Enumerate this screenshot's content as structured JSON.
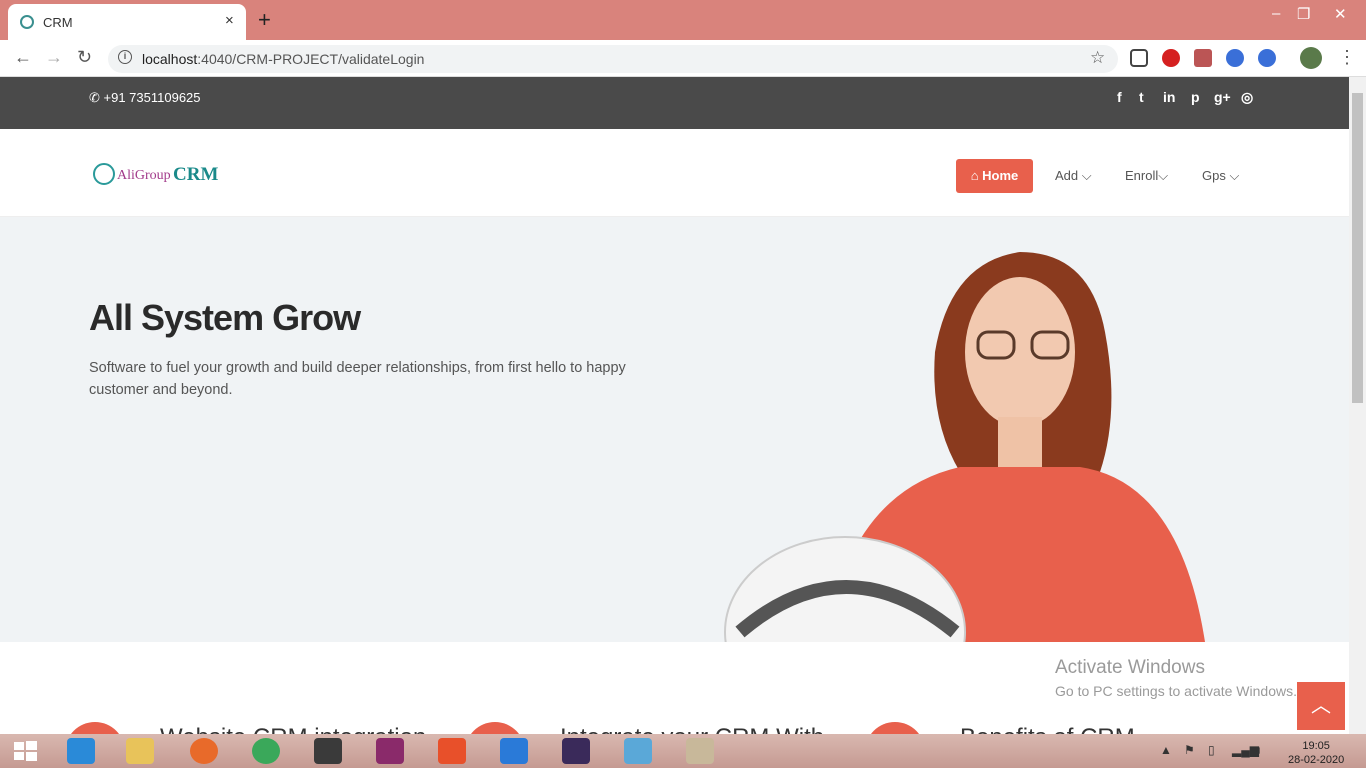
{
  "browser": {
    "tab_title": "CRM",
    "tab_close": "×",
    "new_tab": "+",
    "url_host": "localhost",
    "url_rest": ":4040/CRM-PROJECT/validateLogin",
    "win_minimize": "–",
    "win_restore": "❐",
    "win_close": "✕"
  },
  "topbar": {
    "phone": "+91 7351109625",
    "social": [
      "f",
      "t",
      "in",
      "p",
      "g+",
      "◎"
    ]
  },
  "header": {
    "logo_ali": "AliGroup",
    "logo_crm": "CRM",
    "nav": [
      {
        "label": "Home",
        "icon": "home-icon"
      },
      {
        "label": "Add ⌵"
      },
      {
        "label": "Enroll⌵"
      },
      {
        "label": "Gps ⌵"
      }
    ]
  },
  "hero": {
    "title": "All System Grow",
    "text": "Software to fuel your growth and build deeper relationships, from first hello to happy customer and beyond."
  },
  "features": [
    {
      "title": "Website CRM integration"
    },
    {
      "title": "Integrate your CRM With"
    },
    {
      "title": "Benefits of CRM"
    }
  ],
  "activate": {
    "line1": "Activate Windows",
    "line2": "Go to PC settings to activate Windows."
  },
  "taskbar": {
    "time": "19:05",
    "date": "28-02-2020"
  },
  "colors": {
    "accent": "#e8604c",
    "topbar": "#4a4a4a",
    "hero_bg": "#f0f3f5",
    "titlebar": "#d9837c"
  }
}
